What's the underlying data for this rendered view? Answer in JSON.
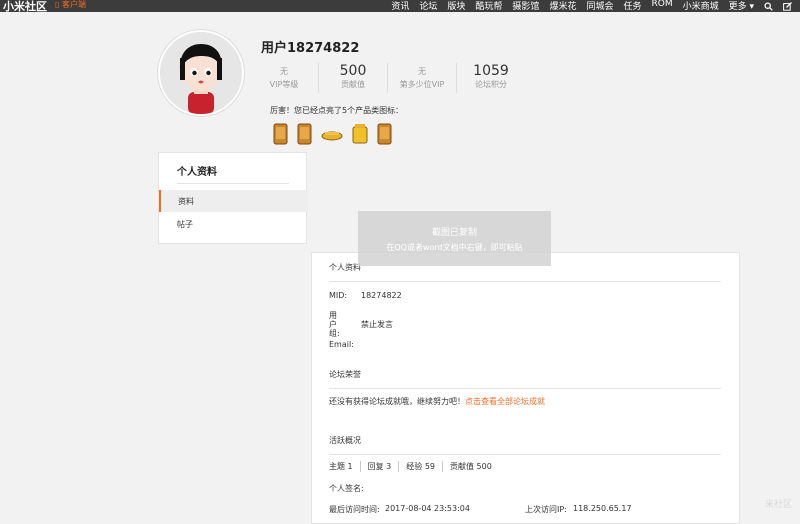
{
  "topbar": {
    "logo": "小米社区",
    "client_badge": "▯ 客户端",
    "nav": [
      "资讯",
      "论坛",
      "版块",
      "酷玩帮",
      "摄影馆",
      "爆米花",
      "同城会",
      "任务",
      "ROM",
      "小米商城",
      "更多 ▾"
    ]
  },
  "profile": {
    "username": "用户18274822",
    "stats": [
      {
        "value": "无",
        "label": "VIP等级"
      },
      {
        "value": "500",
        "label": "贡献值"
      },
      {
        "value": "无",
        "label": "第多少位VIP"
      },
      {
        "value": "1059",
        "label": "论坛积分"
      }
    ],
    "praise": "厉害！您已经点亮了5个产品类图标："
  },
  "sidebar": {
    "title": "个人资料",
    "items": [
      "资料",
      "帖子"
    ]
  },
  "toast": {
    "line1": "截图已复制",
    "line2": "在QQ或者word文档中右键，即可粘贴"
  },
  "panel": {
    "section_profile": "个人资料",
    "mid_label": "MID:",
    "mid_value": "18274822",
    "group_label": "用户组:",
    "group_value": "禁止发言",
    "email_label": "Email:",
    "section_honor": "论坛荣誉",
    "honor_text": "还没有获得论坛成就哦，继续努力吧！",
    "honor_link": "点击查看全部论坛成就",
    "section_activity": "活跃概况",
    "activity": [
      "主题 1",
      "回复 3",
      "经验 59",
      "贡献值 500"
    ],
    "signature_label": "个人签名:",
    "last_visit_label": "最后访问时间:",
    "last_visit_value": "2017-08-04 23:53:04",
    "last_ip_label": "上次访问IP:",
    "last_ip_value": "118.250.65.17"
  },
  "watermark": "米社区"
}
